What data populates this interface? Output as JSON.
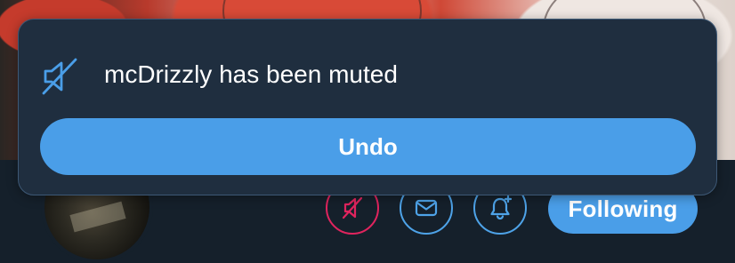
{
  "toast": {
    "message": "mcDrizzly has been muted",
    "icon": "muted-speaker-icon",
    "undo_label": "Undo"
  },
  "profile_actions": {
    "mute_icon": "muted-speaker-icon",
    "message_icon": "envelope-icon",
    "notify_icon": "bell-plus-icon",
    "following_label": "Following"
  },
  "colors": {
    "accent": "#4a9ee8",
    "mute_accent": "#e0245e",
    "toast_bg": "#1f2e3f",
    "page_bg": "#15202b"
  }
}
